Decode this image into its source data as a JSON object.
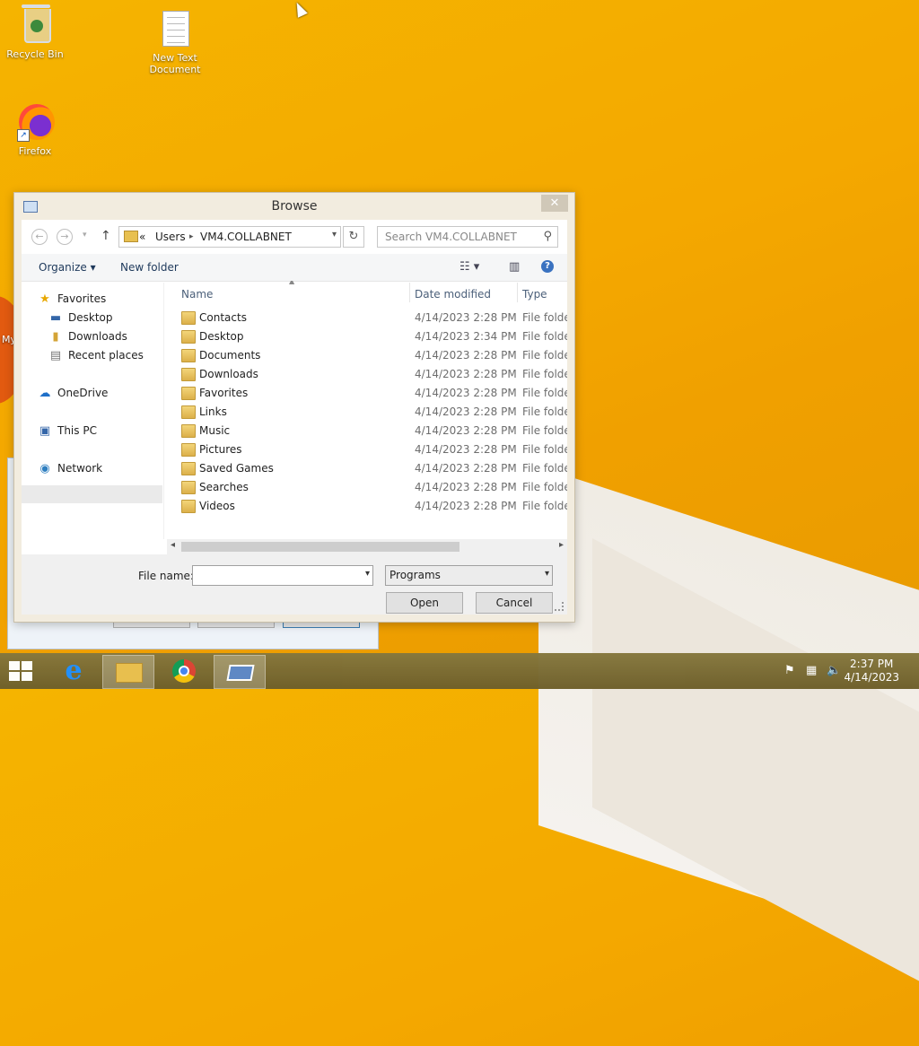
{
  "desktop": {
    "icons": [
      {
        "label": "Recycle Bin"
      },
      {
        "label": "New Text Document"
      },
      {
        "label": "Firefox"
      }
    ],
    "peek_text": "My"
  },
  "dialog": {
    "title": "Browse",
    "close_glyph": "✕",
    "address": {
      "overflow": "«",
      "crumbs": [
        "Users",
        "VM4.COLLABNET"
      ]
    },
    "search_placeholder": "Search VM4.COLLABNET",
    "toolbar": {
      "organize": "Organize",
      "new_folder": "New folder"
    },
    "nav": {
      "favorites": "Favorites",
      "desktop": "Desktop",
      "downloads": "Downloads",
      "recent": "Recent places",
      "onedrive": "OneDrive",
      "thispc": "This PC",
      "network": "Network"
    },
    "columns": {
      "name": "Name",
      "date": "Date modified",
      "type": "Type"
    },
    "files": [
      {
        "name": "Contacts",
        "date": "4/14/2023 2:28 PM",
        "type": "File folder"
      },
      {
        "name": "Desktop",
        "date": "4/14/2023 2:34 PM",
        "type": "File folder"
      },
      {
        "name": "Documents",
        "date": "4/14/2023 2:28 PM",
        "type": "File folder"
      },
      {
        "name": "Downloads",
        "date": "4/14/2023 2:28 PM",
        "type": "File folder"
      },
      {
        "name": "Favorites",
        "date": "4/14/2023 2:28 PM",
        "type": "File folder"
      },
      {
        "name": "Links",
        "date": "4/14/2023 2:28 PM",
        "type": "File folder"
      },
      {
        "name": "Music",
        "date": "4/14/2023 2:28 PM",
        "type": "File folder"
      },
      {
        "name": "Pictures",
        "date": "4/14/2023 2:28 PM",
        "type": "File folder"
      },
      {
        "name": "Saved Games",
        "date": "4/14/2023 2:28 PM",
        "type": "File folder"
      },
      {
        "name": "Searches",
        "date": "4/14/2023 2:28 PM",
        "type": "File folder"
      },
      {
        "name": "Videos",
        "date": "4/14/2023 2:28 PM",
        "type": "File folder"
      }
    ],
    "filename_label": "File name:",
    "filename_value": "",
    "filter_value": "Programs",
    "open_label": "Open",
    "cancel_label": "Cancel"
  },
  "taskbar": {
    "time": "2:37 PM",
    "date": "4/14/2023"
  }
}
